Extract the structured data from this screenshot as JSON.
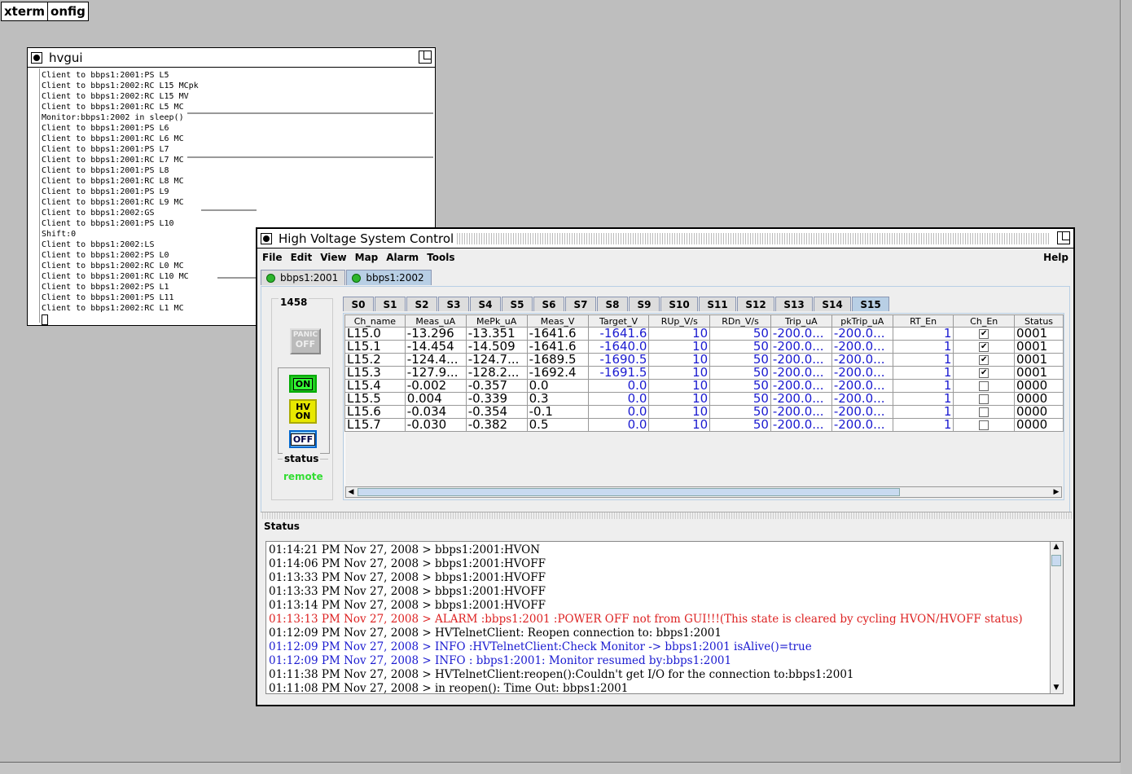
{
  "desktop": {
    "label_parts": [
      "xterm",
      "onfig"
    ]
  },
  "hvgui": {
    "title": "hvgui",
    "lines": [
      "Client to bbps1:2001:PS L5",
      "Client to bbps1:2002:RC L15 MCpk",
      "Client to bbps1:2002:RC L15 MV",
      "Client to bbps1:2001:RC L5 MC",
      "Monitor:bbps1:2002 in sleep()",
      "Client to bbps1:2001:PS L6",
      "Client to bbps1:2001:RC L6 MC",
      "Client to bbps1:2001:PS L7",
      "Client to bbps1:2001:RC L7 MC",
      "Client to bbps1:2001:PS L8",
      "Client to bbps1:2001:RC L8 MC",
      "Client to bbps1:2001:PS L9",
      "Client to bbps1:2001:RC L9 MC",
      "Client to bbps1:2002:GS",
      "Client to bbps1:2001:PS L10",
      "Shift:0",
      "Client to bbps1:2002:LS",
      "Client to bbps1:2002:PS L0",
      "Client to bbps1:2002:RC L0 MC",
      "Client to bbps1:2001:RC L10 MC",
      "Client to bbps1:2002:PS L1",
      "Client to bbps1:2001:PS L11",
      "Client to bbps1:2002:RC L1 MC"
    ]
  },
  "hv": {
    "title": "High Voltage System Control",
    "menu": [
      "File",
      "Edit",
      "View",
      "Map",
      "Alarm",
      "Tools"
    ],
    "help": "Help",
    "crates": [
      {
        "label": "bbps1:2001",
        "led": "#2db52d",
        "selected": false
      },
      {
        "label": "bbps1:2002",
        "led": "#2db52d",
        "selected": true
      }
    ],
    "counter": "1458",
    "panic": {
      "line1": "PANIC",
      "line2": "OFF"
    },
    "on_label": "ON",
    "hvon": {
      "line1": "HV",
      "line2": "ON"
    },
    "off_label": "OFF",
    "status_label": "status",
    "status_value": "remote",
    "slots": [
      "S0",
      "S1",
      "S2",
      "S3",
      "S4",
      "S5",
      "S6",
      "S7",
      "S8",
      "S9",
      "S10",
      "S11",
      "S12",
      "S13",
      "S14",
      "S15"
    ],
    "selected_slot": "S15",
    "columns": [
      "Ch_name",
      "Meas_uA",
      "MePk_uA",
      "Meas_V",
      "Target_V",
      "RUp_V/s",
      "RDn_V/s",
      "Trip_uA",
      "pkTrip_uA",
      "RT_En",
      "Ch_En",
      "Status"
    ],
    "rows": [
      {
        "ch": "L15.0",
        "meas_ua": "-13.296",
        "mepk_ua": "-13.351",
        "meas_v": "-1641.6",
        "target_v": "-1641.6",
        "rup": "10",
        "rdn": "50",
        "trip": "-200.0...",
        "pktrip": "-200.0...",
        "rt_en": "1",
        "ch_en": true,
        "status": "0001"
      },
      {
        "ch": "L15.1",
        "meas_ua": "-14.454",
        "mepk_ua": "-14.509",
        "meas_v": "-1641.6",
        "target_v": "-1640.0",
        "rup": "10",
        "rdn": "50",
        "trip": "-200.0...",
        "pktrip": "-200.0...",
        "rt_en": "1",
        "ch_en": true,
        "status": "0001"
      },
      {
        "ch": "L15.2",
        "meas_ua": "-124.4...",
        "mepk_ua": "-124.7...",
        "meas_v": "-1689.5",
        "target_v": "-1690.5",
        "rup": "10",
        "rdn": "50",
        "trip": "-200.0...",
        "pktrip": "-200.0...",
        "rt_en": "1",
        "ch_en": true,
        "status": "0001"
      },
      {
        "ch": "L15.3",
        "meas_ua": "-127.9...",
        "mepk_ua": "-128.2...",
        "meas_v": "-1692.4",
        "target_v": "-1691.5",
        "rup": "10",
        "rdn": "50",
        "trip": "-200.0...",
        "pktrip": "-200.0...",
        "rt_en": "1",
        "ch_en": true,
        "status": "0001"
      },
      {
        "ch": "L15.4",
        "meas_ua": "-0.002",
        "mepk_ua": "-0.357",
        "meas_v": "0.0",
        "target_v": "0.0",
        "rup": "10",
        "rdn": "50",
        "trip": "-200.0...",
        "pktrip": "-200.0...",
        "rt_en": "1",
        "ch_en": false,
        "status": "0000"
      },
      {
        "ch": "L15.5",
        "meas_ua": "0.004",
        "mepk_ua": "-0.339",
        "meas_v": "0.3",
        "target_v": "0.0",
        "rup": "10",
        "rdn": "50",
        "trip": "-200.0...",
        "pktrip": "-200.0...",
        "rt_en": "1",
        "ch_en": false,
        "status": "0000"
      },
      {
        "ch": "L15.6",
        "meas_ua": "-0.034",
        "mepk_ua": "-0.354",
        "meas_v": "-0.1",
        "target_v": "0.0",
        "rup": "10",
        "rdn": "50",
        "trip": "-200.0...",
        "pktrip": "-200.0...",
        "rt_en": "1",
        "ch_en": false,
        "status": "0000"
      },
      {
        "ch": "L15.7",
        "meas_ua": "-0.030",
        "mepk_ua": "-0.382",
        "meas_v": "0.5",
        "target_v": "0.0",
        "rup": "10",
        "rdn": "50",
        "trip": "-200.0...",
        "pktrip": "-200.0...",
        "rt_en": "1",
        "ch_en": false,
        "status": "0000"
      }
    ],
    "status_title": "Status",
    "log": [
      {
        "text": "01:14:21 PM Nov 27, 2008 > bbps1:2001:HVON",
        "color": "#000000"
      },
      {
        "text": "01:14:06 PM Nov 27, 2008 > bbps1:2001:HVOFF",
        "color": "#000000"
      },
      {
        "text": "01:13:33 PM Nov 27, 2008 > bbps1:2001:HVOFF",
        "color": "#000000"
      },
      {
        "text": "01:13:33 PM Nov 27, 2008 > bbps1:2001:HVOFF",
        "color": "#000000"
      },
      {
        "text": "01:13:14 PM Nov 27, 2008 > bbps1:2001:HVOFF",
        "color": "#000000"
      },
      {
        "text": "01:13:13 PM Nov 27, 2008 > ALARM :bbps1:2001 :POWER OFF not from GUI!!!(This state is cleared by cycling HVON/HVOFF status)",
        "color": "#dd2222"
      },
      {
        "text": "01:12:09 PM Nov 27, 2008 > HVTelnetClient: Reopen connection to: bbps1:2001",
        "color": "#000000"
      },
      {
        "text": "01:12:09 PM Nov 27, 2008 > INFO :HVTelnetClient:Check Monitor -> bbps1:2001 isAlive()=true",
        "color": "#1a1ad0"
      },
      {
        "text": "01:12:09 PM Nov 27, 2008 > INFO : bbps1:2001: Monitor resumed by:bbps1:2001",
        "color": "#1a1ad0"
      },
      {
        "text": "01:11:38 PM Nov 27, 2008 > HVTelnetClient:reopen():Couldn't get I/O for the connection to:bbps1:2001",
        "color": "#000000"
      },
      {
        "text": "01:11:08 PM Nov 27, 2008 > in reopen(): Time Out: bbps1:2001",
        "color": "#000000"
      }
    ]
  }
}
